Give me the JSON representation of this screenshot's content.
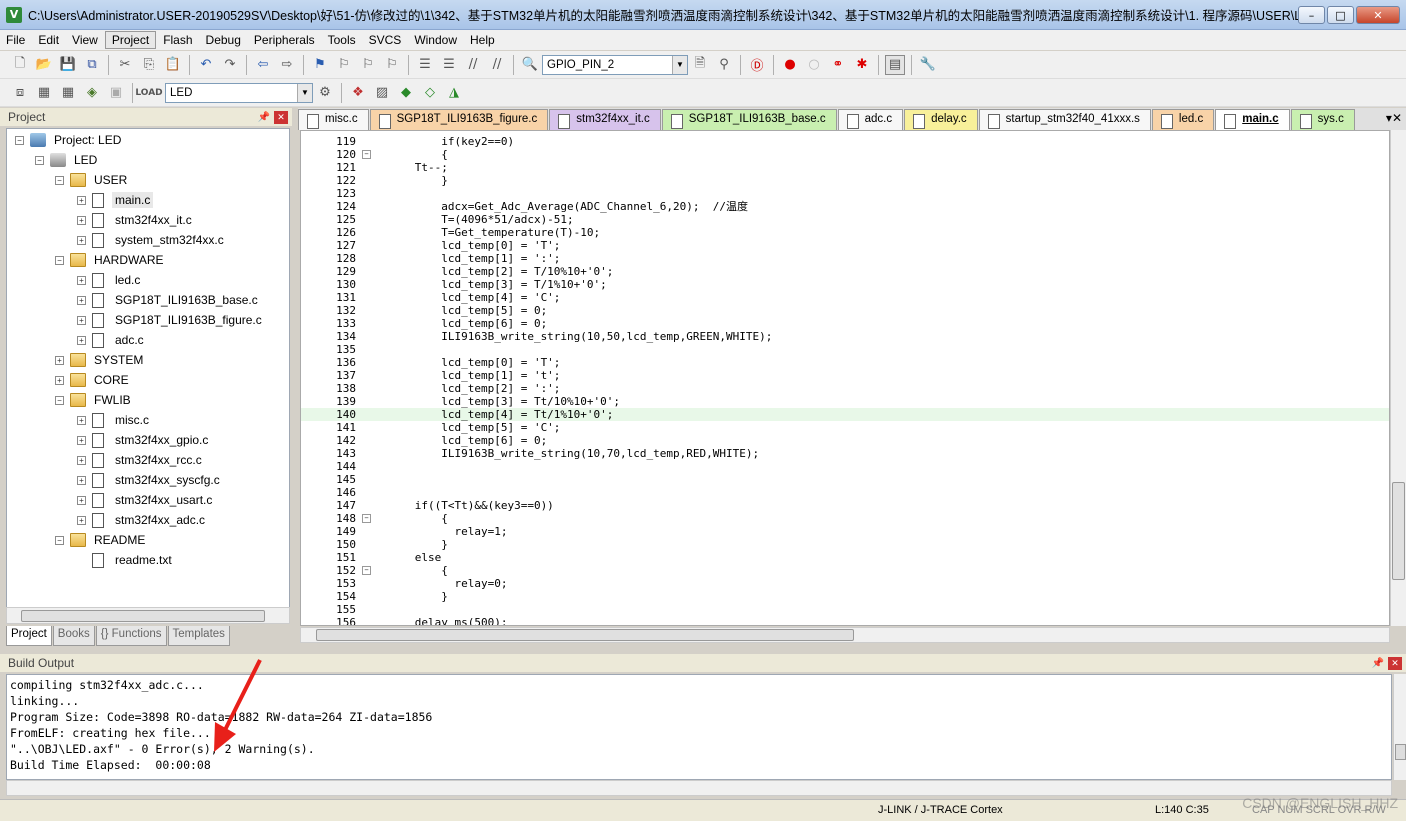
{
  "window": {
    "title": "C:\\Users\\Administrator.USER-20190529SV\\Desktop\\好\\51-仿\\修改过的\\1\\342、基于STM32单片机的太阳能融雪剂喷洒温度雨滴控制系统设计\\342、基于STM32单片机的太阳能融雪剂喷洒温度雨滴控制系统设计\\1. 程序源码\\USER\\LE...",
    "minimize": "–",
    "maximize": "□",
    "close": "✕"
  },
  "menu": [
    "File",
    "Edit",
    "View",
    "Project",
    "Flash",
    "Debug",
    "Peripherals",
    "Tools",
    "SVCS",
    "Window",
    "Help"
  ],
  "toolbar1": {
    "search_value": "GPIO_PIN_2"
  },
  "toolbar2": {
    "target_value": "LED"
  },
  "project_panel": {
    "title": "Project",
    "tree": [
      {
        "label": "Project: LED",
        "level": 0,
        "kind": "root"
      },
      {
        "label": "LED",
        "level": 1,
        "kind": "target"
      },
      {
        "label": "USER",
        "level": 2,
        "kind": "folder",
        "open": true
      },
      {
        "label": "main.c",
        "level": 3,
        "kind": "file",
        "selected": true
      },
      {
        "label": "stm32f4xx_it.c",
        "level": 3,
        "kind": "file"
      },
      {
        "label": "system_stm32f4xx.c",
        "level": 3,
        "kind": "file"
      },
      {
        "label": "HARDWARE",
        "level": 2,
        "kind": "folder",
        "open": true
      },
      {
        "label": "led.c",
        "level": 3,
        "kind": "file"
      },
      {
        "label": "SGP18T_ILI9163B_base.c",
        "level": 3,
        "kind": "file"
      },
      {
        "label": "SGP18T_ILI9163B_figure.c",
        "level": 3,
        "kind": "file"
      },
      {
        "label": "adc.c",
        "level": 3,
        "kind": "file"
      },
      {
        "label": "SYSTEM",
        "level": 2,
        "kind": "folder",
        "open": false
      },
      {
        "label": "CORE",
        "level": 2,
        "kind": "folder",
        "open": false
      },
      {
        "label": "FWLIB",
        "level": 2,
        "kind": "folder",
        "open": true
      },
      {
        "label": "misc.c",
        "level": 3,
        "kind": "file"
      },
      {
        "label": "stm32f4xx_gpio.c",
        "level": 3,
        "kind": "file"
      },
      {
        "label": "stm32f4xx_rcc.c",
        "level": 3,
        "kind": "file"
      },
      {
        "label": "stm32f4xx_syscfg.c",
        "level": 3,
        "kind": "file"
      },
      {
        "label": "stm32f4xx_usart.c",
        "level": 3,
        "kind": "file"
      },
      {
        "label": "stm32f4xx_adc.c",
        "level": 3,
        "kind": "file"
      },
      {
        "label": "README",
        "level": 2,
        "kind": "folder",
        "open": true
      },
      {
        "label": "readme.txt",
        "level": 3,
        "kind": "file",
        "noexp": true
      }
    ],
    "bottom_tabs": [
      "Project",
      "Books",
      "{} Functions",
      "Templates"
    ]
  },
  "editor": {
    "tabs": [
      {
        "label": "misc.c",
        "color": "#f7f7f7",
        "active": false
      },
      {
        "label": "SGP18T_ILI9163B_figure.c",
        "color": "#f8d3a8",
        "active": false
      },
      {
        "label": "stm32f4xx_it.c",
        "color": "#d7c3ec",
        "active": false
      },
      {
        "label": "SGP18T_ILI9163B_base.c",
        "color": "#c9efb0",
        "active": false
      },
      {
        "label": "adc.c",
        "color": "#f7f7f7",
        "active": false
      },
      {
        "label": "delay.c",
        "color": "#f8f09a",
        "active": false
      },
      {
        "label": "startup_stm32f40_41xxx.s",
        "color": "#f7f7f7",
        "active": false
      },
      {
        "label": "led.c",
        "color": "#f8d3a8",
        "active": false
      },
      {
        "label": "main.c",
        "color": "#ffffff",
        "active": true
      },
      {
        "label": "sys.c",
        "color": "#c9efb0",
        "active": false
      }
    ],
    "lines": [
      {
        "n": "119",
        "code": "          if(key2==0)",
        "fold": false
      },
      {
        "n": "120",
        "code": "          {",
        "fold": true
      },
      {
        "n": "121",
        "code": "      Tt--;",
        "fold": false
      },
      {
        "n": "122",
        "code": "          }",
        "fold": false
      },
      {
        "n": "123",
        "code": "",
        "fold": false
      },
      {
        "n": "124",
        "code": "          adcx=Get_Adc_Average(ADC_Channel_6,20);  //温度",
        "fold": false
      },
      {
        "n": "125",
        "code": "          T=(4096*51/adcx)-51;",
        "fold": false
      },
      {
        "n": "126",
        "code": "          T=Get_temperature(T)-10;",
        "fold": false
      },
      {
        "n": "127",
        "code": "          lcd_temp[0] = 'T';",
        "fold": false
      },
      {
        "n": "128",
        "code": "          lcd_temp[1] = ':';",
        "fold": false
      },
      {
        "n": "129",
        "code": "          lcd_temp[2] = T/10%10+'0';",
        "fold": false
      },
      {
        "n": "130",
        "code": "          lcd_temp[3] = T/1%10+'0';",
        "fold": false
      },
      {
        "n": "131",
        "code": "          lcd_temp[4] = 'C';",
        "fold": false
      },
      {
        "n": "132",
        "code": "          lcd_temp[5] = 0;",
        "fold": false
      },
      {
        "n": "133",
        "code": "          lcd_temp[6] = 0;",
        "fold": false
      },
      {
        "n": "134",
        "code": "          ILI9163B_write_string(10,50,lcd_temp,GREEN,WHITE);",
        "fold": false
      },
      {
        "n": "135",
        "code": "",
        "fold": false
      },
      {
        "n": "136",
        "code": "          lcd_temp[0] = 'T';",
        "fold": false
      },
      {
        "n": "137",
        "code": "          lcd_temp[1] = 't';",
        "fold": false
      },
      {
        "n": "138",
        "code": "          lcd_temp[2] = ':';",
        "fold": false
      },
      {
        "n": "139",
        "code": "          lcd_temp[3] = Tt/10%10+'0';",
        "fold": false
      },
      {
        "n": "140",
        "code": "          lcd_temp[4] = Tt/1%10+'0';",
        "fold": false,
        "highlight": true
      },
      {
        "n": "141",
        "code": "          lcd_temp[5] = 'C';",
        "fold": false
      },
      {
        "n": "142",
        "code": "          lcd_temp[6] = 0;",
        "fold": false
      },
      {
        "n": "143",
        "code": "          ILI9163B_write_string(10,70,lcd_temp,RED,WHITE);",
        "fold": false
      },
      {
        "n": "144",
        "code": "",
        "fold": false
      },
      {
        "n": "145",
        "code": "",
        "fold": false
      },
      {
        "n": "146",
        "code": "",
        "fold": false
      },
      {
        "n": "147",
        "code": "      if((T<Tt)&&(key3==0))",
        "fold": false
      },
      {
        "n": "148",
        "code": "          {",
        "fold": true
      },
      {
        "n": "149",
        "code": "            relay=1;",
        "fold": false
      },
      {
        "n": "150",
        "code": "          }",
        "fold": false
      },
      {
        "n": "151",
        "code": "      else",
        "fold": false
      },
      {
        "n": "152",
        "code": "          {",
        "fold": true
      },
      {
        "n": "153",
        "code": "            relay=0;",
        "fold": false
      },
      {
        "n": "154",
        "code": "          }",
        "fold": false
      },
      {
        "n": "155",
        "code": "",
        "fold": false
      },
      {
        "n": "156",
        "code": "      delay_ms(500);",
        "fold": false
      }
    ]
  },
  "build_output": {
    "title": "Build Output",
    "lines": [
      "compiling stm32f4xx_adc.c...",
      "linking...",
      "Program Size: Code=3898 RO-data=1882 RW-data=264 ZI-data=1856",
      "FromELF: creating hex file...",
      "\"..\\OBJ\\LED.axf\" - 0 Error(s), 2 Warning(s).",
      "Build Time Elapsed:  00:00:08"
    ]
  },
  "status": {
    "debugger": "J-LINK / J-TRACE Cortex",
    "position": "L:140 C:35",
    "flags": "CAP NUM SCRL OVR R/W"
  },
  "watermark": "CSDN @ENGLISH_HHZ",
  "colors": {
    "arrow": "#e8201a",
    "highlight_line": "#e8f8e8"
  }
}
